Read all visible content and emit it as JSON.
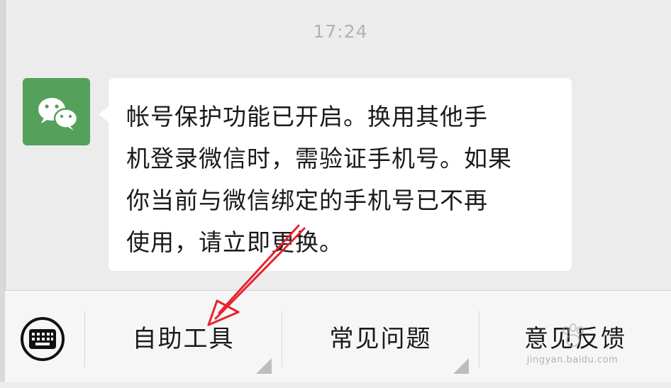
{
  "chat": {
    "timestamp": "17:24",
    "message": {
      "sender_avatar_icon": "wechat-logo-icon",
      "line1": "帐号保护功能已开启。换用其他手",
      "line2": "机登录微信时，需验证手机号。如果",
      "line3": "你当前与微信绑定的手机号已不再",
      "line4": "使用，请立即更换。"
    }
  },
  "bottom_menu": {
    "keyboard_icon": "keyboard-icon",
    "items": [
      {
        "label": "自助工具"
      },
      {
        "label": "常见问题"
      },
      {
        "label": "意见反馈"
      }
    ]
  },
  "annotation": {
    "arrow_color": "#e8232e"
  },
  "watermark": {
    "logo": "Bai经验",
    "url": "jingyan.baidu.com"
  },
  "colors": {
    "background": "#ececec",
    "avatar_green": "#55a05a",
    "bubble": "#ffffff",
    "timestamp": "#b2b2b2"
  }
}
